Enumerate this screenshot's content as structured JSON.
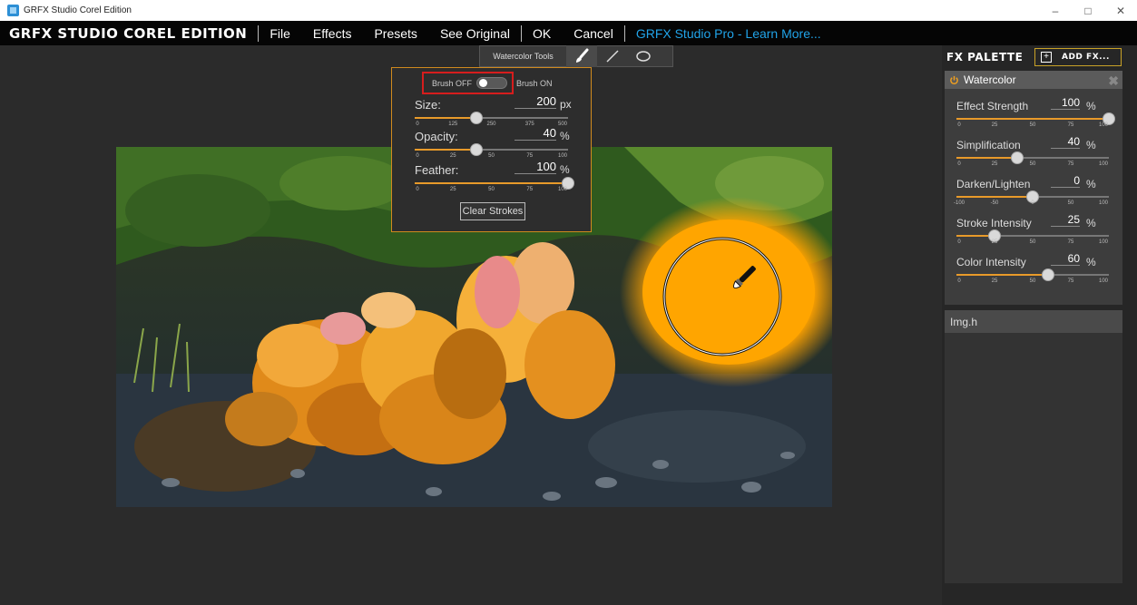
{
  "window": {
    "title": "GRFX Studio Corel Edition",
    "minimize": "–",
    "maximize": "□",
    "close": "✕"
  },
  "menubar": {
    "brand": "GRFX STUDIO COREL EDITION",
    "items": [
      "File",
      "Effects",
      "Presets",
      "See Original"
    ],
    "ok": "OK",
    "cancel": "Cancel",
    "promo": "GRFX Studio Pro - Learn More..."
  },
  "toolstrip": {
    "label": "Watercolor Tools",
    "tools": [
      "brush-icon",
      "line-icon",
      "ellipse-icon"
    ],
    "active_tool": "brush"
  },
  "popup": {
    "brush_off": "Brush OFF",
    "brush_on": "Brush ON",
    "brush_enabled": false,
    "sliders": [
      {
        "label": "Size:",
        "value": "200",
        "unit": "px",
        "min": 0,
        "max": 500,
        "ticks": [
          "0",
          "125",
          "250",
          "375",
          "500"
        ]
      },
      {
        "label": "Opacity:",
        "value": "40",
        "unit": "%",
        "min": 0,
        "max": 100,
        "ticks": [
          "0",
          "25",
          "50",
          "75",
          "100"
        ]
      },
      {
        "label": "Feather:",
        "value": "100",
        "unit": "%",
        "min": 0,
        "max": 100,
        "ticks": [
          "0",
          "25",
          "50",
          "75",
          "100"
        ]
      }
    ],
    "clear_button": "Clear Strokes"
  },
  "fxpanel": {
    "title": "FX PALETTE",
    "add_label": "ADD FX...",
    "effect": {
      "name": "Watercolor",
      "sliders": [
        {
          "label": "Effect Strength",
          "value": "100",
          "unit": "%",
          "min": 0,
          "max": 100,
          "ticks": [
            "0",
            "25",
            "50",
            "75",
            "100"
          ]
        },
        {
          "label": "Simplification",
          "value": "40",
          "unit": "%",
          "min": 0,
          "max": 100,
          "ticks": [
            "0",
            "25",
            "50",
            "75",
            "100"
          ]
        },
        {
          "label": "Darken/Lighten",
          "value": "0",
          "unit": "%",
          "min": -100,
          "max": 100,
          "ticks": [
            "-100",
            "-50",
            "0",
            "50",
            "100"
          ]
        },
        {
          "label": "Stroke Intensity",
          "value": "25",
          "unit": "%",
          "min": 0,
          "max": 100,
          "ticks": [
            "0",
            "25",
            "50",
            "75",
            "100"
          ]
        },
        {
          "label": "Color Intensity",
          "value": "60",
          "unit": "%",
          "min": 0,
          "max": 100,
          "ticks": [
            "0",
            "25",
            "50",
            "75",
            "100"
          ]
        }
      ]
    },
    "preset_name": "Img.h"
  },
  "colors": {
    "accent": "#e89a2a",
    "promo": "#21a3e8",
    "highlight_border": "#d61d1d",
    "brush_fill": "#ffa500"
  }
}
